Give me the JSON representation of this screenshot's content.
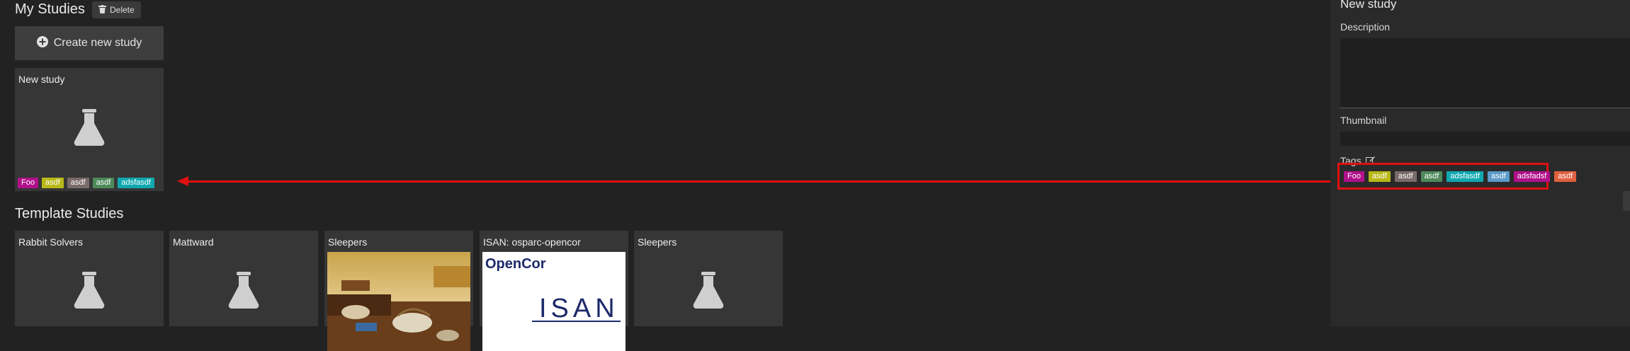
{
  "my_studies": {
    "title": "My Studies",
    "delete_label": "Delete",
    "create_label": "Create new study",
    "cards": [
      {
        "title": "New study",
        "tags": [
          {
            "label": "Foo",
            "color": "#b0108a"
          },
          {
            "label": "asdf",
            "color": "#b8b818"
          },
          {
            "label": "asdf",
            "color": "#7a6a6a"
          },
          {
            "label": "asdf",
            "color": "#4e8a5a"
          },
          {
            "label": "adsfasdf",
            "color": "#10a8b0"
          }
        ]
      }
    ]
  },
  "templates": {
    "title": "Template Studies",
    "cards": [
      {
        "title": "Rabbit Solvers",
        "thumbnail": "flask-icon"
      },
      {
        "title": "Mattward",
        "thumbnail": "flask-icon"
      },
      {
        "title": "Sleepers",
        "thumbnail": "painting-image"
      },
      {
        "title": "ISAN: osparc-opencor",
        "thumbnail": "opencor-logo",
        "logo_title": "OpenCor",
        "logo_text": "ISAN"
      },
      {
        "title": "Sleepers",
        "thumbnail": "flask-icon"
      }
    ]
  },
  "details_panel": {
    "title": "New study",
    "description_label": "Description",
    "thumbnail_label": "Thumbnail",
    "tags_label": "Tags",
    "tags": [
      {
        "label": "Foo",
        "color": "#b0108a"
      },
      {
        "label": "asdf",
        "color": "#b8b818"
      },
      {
        "label": "asdf",
        "color": "#7a6a6a"
      },
      {
        "label": "asdf",
        "color": "#4e8a5a"
      },
      {
        "label": "adsfasdf",
        "color": "#10a8b0"
      },
      {
        "label": "asdf",
        "color": "#5a9ac8"
      },
      {
        "label": "adsfadsf",
        "color": "#b0108a"
      },
      {
        "label": "asdf",
        "color": "#e06040"
      }
    ]
  },
  "annotation_color": "#e01010"
}
